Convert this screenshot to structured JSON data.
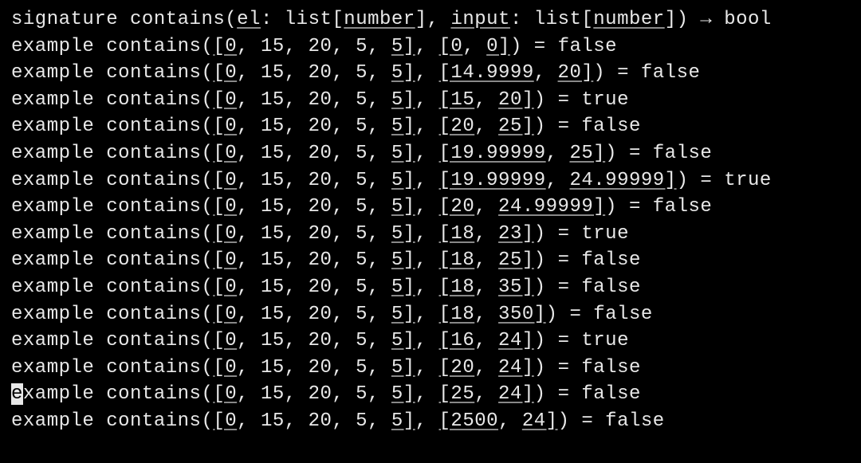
{
  "signature": {
    "keyword": "signature",
    "name": "contains",
    "param1_name": "el",
    "param1_type": "list[number]",
    "param2_name": "input",
    "param2_type": "list[number]",
    "return_type": "bool"
  },
  "examples": [
    {
      "keyword": "example",
      "fn": "contains",
      "arg1": "[0, 15, 20, 5, 5]",
      "arg2": "[0, 0]",
      "result": "false",
      "cursor": false
    },
    {
      "keyword": "example",
      "fn": "contains",
      "arg1": "[0, 15, 20, 5, 5]",
      "arg2": "[14.9999, 20]",
      "result": "false",
      "cursor": false
    },
    {
      "keyword": "example",
      "fn": "contains",
      "arg1": "[0, 15, 20, 5, 5]",
      "arg2": "[15, 20]",
      "result": "true",
      "cursor": false
    },
    {
      "keyword": "example",
      "fn": "contains",
      "arg1": "[0, 15, 20, 5, 5]",
      "arg2": "[20, 25]",
      "result": "false",
      "cursor": false
    },
    {
      "keyword": "example",
      "fn": "contains",
      "arg1": "[0, 15, 20, 5, 5]",
      "arg2": "[19.99999, 25]",
      "result": "false",
      "cursor": false
    },
    {
      "keyword": "example",
      "fn": "contains",
      "arg1": "[0, 15, 20, 5, 5]",
      "arg2": "[19.99999, 24.99999]",
      "result": "true",
      "cursor": false
    },
    {
      "keyword": "example",
      "fn": "contains",
      "arg1": "[0, 15, 20, 5, 5]",
      "arg2": "[20, 24.99999]",
      "result": "false",
      "cursor": false
    },
    {
      "keyword": "example",
      "fn": "contains",
      "arg1": "[0, 15, 20, 5, 5]",
      "arg2": "[18, 23]",
      "result": "true",
      "cursor": false
    },
    {
      "keyword": "example",
      "fn": "contains",
      "arg1": "[0, 15, 20, 5, 5]",
      "arg2": "[18, 25]",
      "result": "false",
      "cursor": false
    },
    {
      "keyword": "example",
      "fn": "contains",
      "arg1": "[0, 15, 20, 5, 5]",
      "arg2": "[18, 35]",
      "result": "false",
      "cursor": false
    },
    {
      "keyword": "example",
      "fn": "contains",
      "arg1": "[0, 15, 20, 5, 5]",
      "arg2": "[18, 350]",
      "result": "false",
      "cursor": false
    },
    {
      "keyword": "example",
      "fn": "contains",
      "arg1": "[0, 15, 20, 5, 5]",
      "arg2": "[16, 24]",
      "result": "true",
      "cursor": false
    },
    {
      "keyword": "example",
      "fn": "contains",
      "arg1": "[0, 15, 20, 5, 5]",
      "arg2": "[20, 24]",
      "result": "false",
      "cursor": false
    },
    {
      "keyword": "example",
      "fn": "contains",
      "arg1": "[0, 15, 20, 5, 5]",
      "arg2": "[25, 24]",
      "result": "false",
      "cursor": true
    },
    {
      "keyword": "example",
      "fn": "contains",
      "arg1": "[0, 15, 20, 5, 5]",
      "arg2": "[2500, 24]",
      "result": "false",
      "cursor": false
    }
  ]
}
